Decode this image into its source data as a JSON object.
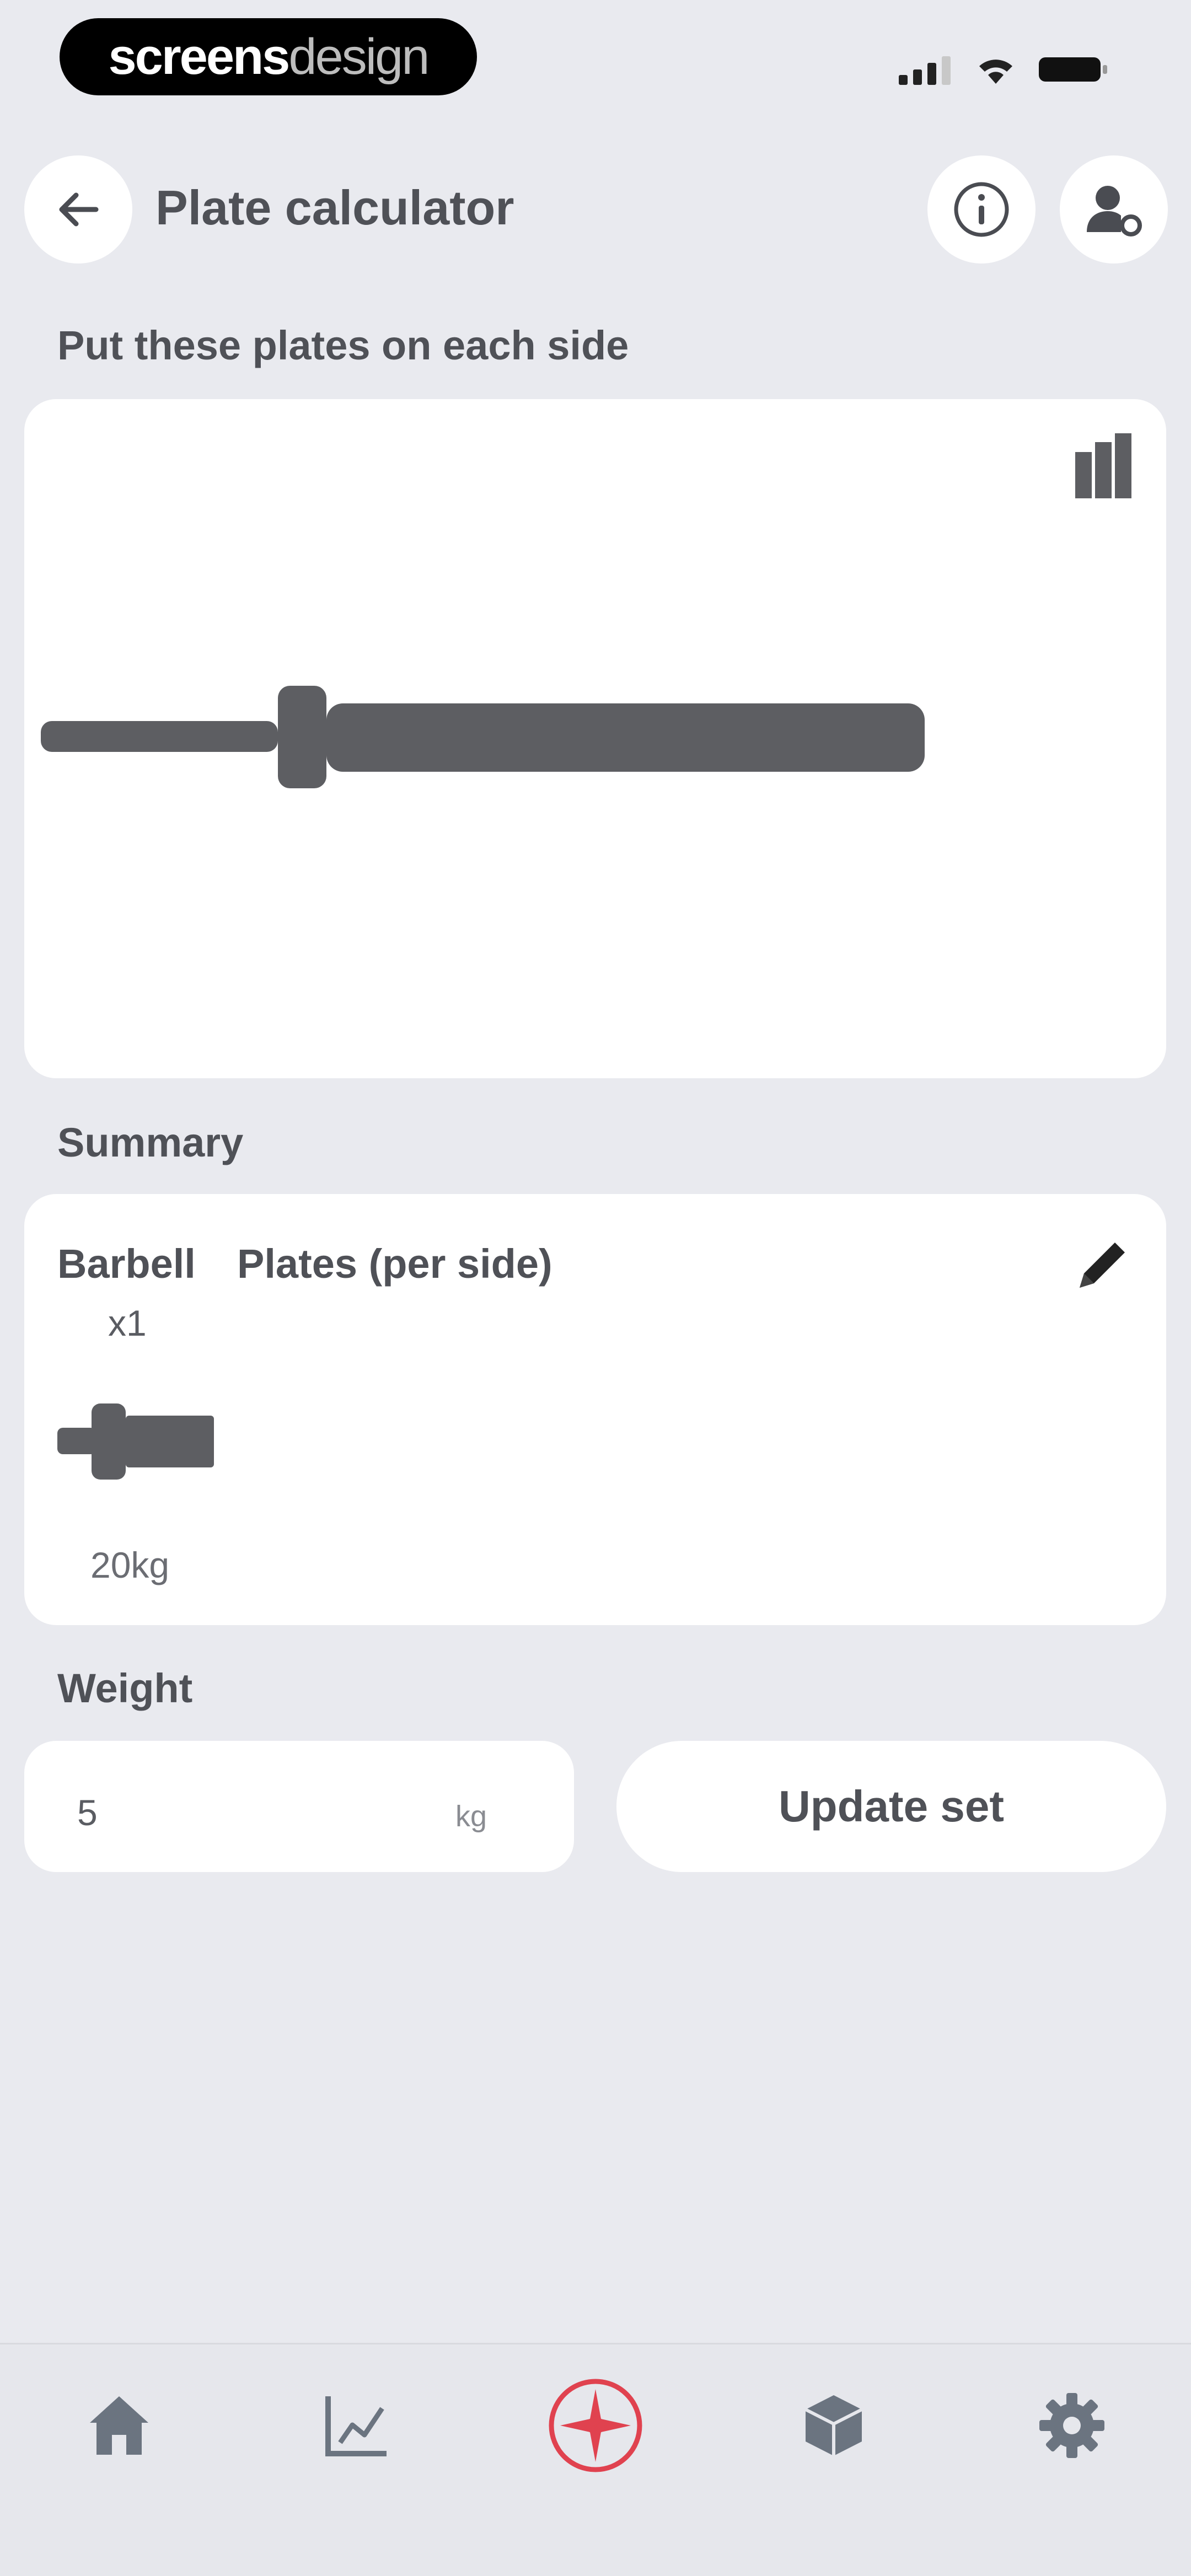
{
  "status_bar": {
    "brand_bold": "screens",
    "brand_light": "design",
    "icons": [
      "cellular-signal-icon",
      "wifi-icon",
      "battery-icon"
    ]
  },
  "header": {
    "title": "Plate calculator",
    "back_icon": "arrow-left-icon",
    "info_icon": "info-icon",
    "profile_icon": "user-settings-icon"
  },
  "plates_section": {
    "label": "Put these plates on each side",
    "plates_per_side": 0,
    "view_toggle_icon": "plates-stack-icon"
  },
  "summary": {
    "label": "Summary",
    "barbell_header": "Barbell",
    "plates_header": "Plates (per side)",
    "barbell_count": "x1",
    "barbell_weight": "20kg",
    "edit_icon": "pencil-icon"
  },
  "weight": {
    "label": "Weight",
    "value": "5",
    "unit": "kg",
    "update_label": "Update set"
  },
  "bottom_nav": {
    "items": [
      {
        "name": "home",
        "icon": "home-icon",
        "active": false
      },
      {
        "name": "progress",
        "icon": "chart-icon",
        "active": false
      },
      {
        "name": "workout",
        "icon": "barbell-disc-icon",
        "active": true
      },
      {
        "name": "exercises",
        "icon": "cube-icon",
        "active": false
      },
      {
        "name": "settings",
        "icon": "gear-icon",
        "active": false
      }
    ],
    "active_color": "#e0424f",
    "inactive_color": "#6b7480"
  },
  "colors": {
    "background": "#e9eaef",
    "card": "#ffffff",
    "barbell": "#5d5e62"
  }
}
